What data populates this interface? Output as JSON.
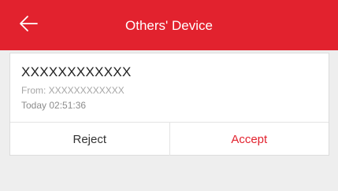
{
  "header": {
    "title": "Others' Device",
    "back_icon": "arrow-left-icon",
    "color": "#e2222e"
  },
  "share_request": {
    "device_name": "XXXXXXXXXXXX",
    "from": "From: XXXXXXXXXXXX",
    "time": "Today 02:51:36",
    "reject_label": "Reject",
    "accept_label": "Accept",
    "accept_color": "#e2222e"
  }
}
